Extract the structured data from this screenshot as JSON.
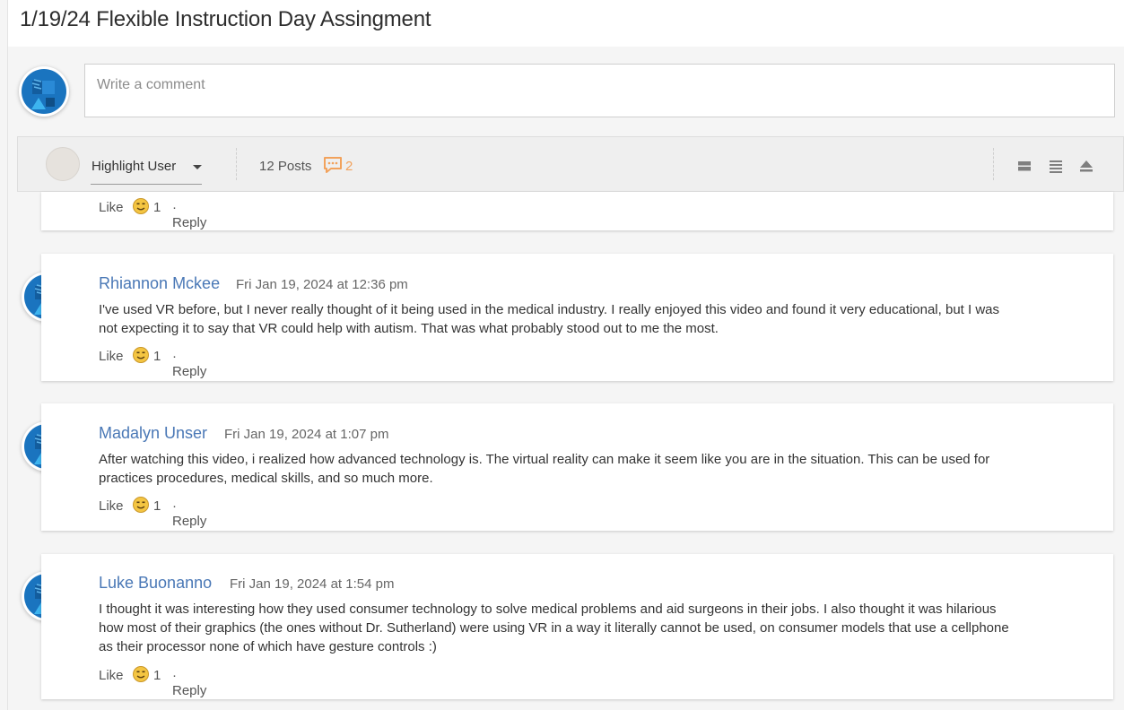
{
  "page": {
    "title": "1/19/24 Flexible Instruction Day Assingment"
  },
  "composer": {
    "placeholder": "Write a comment"
  },
  "toolbar": {
    "highlight_label": "Highlight User",
    "posts_label": "12 Posts",
    "unread_count": "2"
  },
  "actions": {
    "like": "Like",
    "reply": "· Reply"
  },
  "top_partial": {
    "likes": "1"
  },
  "comments": [
    {
      "author": "Rhiannon Mckee",
      "date": "Fri Jan 19, 2024 at 12:36 pm",
      "lines": [
        "I've used VR before, but I never really thought of it being used in the medical industry. I really enjoyed this video and found it very educational, but I was",
        "not expecting it to say that VR could help with autism. That was what probably stood out to me the most."
      ],
      "likes": "1"
    },
    {
      "author": "Madalyn Unser",
      "date": "Fri Jan 19, 2024 at 1:07 pm",
      "lines": [
        "After watching this video, i realized how advanced technology is. The virtual reality can make it seem like you are in the situation. This can be used for",
        "practices procedures, medical skills, and so much more."
      ],
      "likes": "1"
    },
    {
      "author": "Luke Buonanno",
      "date": "Fri Jan 19, 2024 at 1:54 pm",
      "lines": [
        "I thought it was interesting how they used consumer technology to solve medical problems and aid surgeons in their jobs. I also thought it was hilarious",
        "how most of their graphics (the ones without Dr. Sutherland) were using VR in a way it literally cannot be used, on consumer models that use a cellphone",
        "as their processor none of which have gesture controls :)"
      ],
      "likes": "1"
    }
  ],
  "colors": {
    "author_link": "#4a78b6",
    "unread_accent": "#f2a25c",
    "avatar_blue": "#1a74bf"
  },
  "icons": {
    "avatar": "user-avatar-icon",
    "unread": "speech-bubble-icon",
    "emoji": "smiley-face-icon",
    "views": [
      "expand-view-icon",
      "list-view-icon",
      "collapse-view-icon"
    ]
  }
}
